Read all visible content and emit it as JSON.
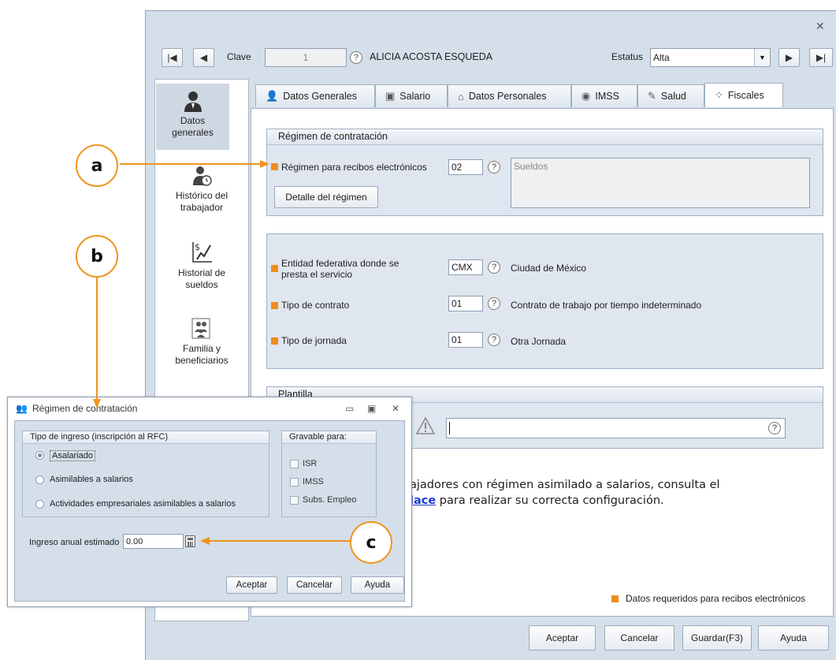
{
  "main_window": {
    "header": {
      "clave_label": "Clave",
      "clave_value": "1",
      "employee_name": "ALICIA ACOSTA ESQUEDA",
      "estatus_label": "Estatus",
      "estatus_value": "Alta"
    },
    "sidebar": {
      "items": [
        {
          "label_line1": "Datos",
          "label_line2": "generales",
          "icon": "person-icon"
        },
        {
          "label_line1": "Histórico del",
          "label_line2": "trabajador",
          "icon": "person-clock-icon"
        },
        {
          "label_line1": "Historial de",
          "label_line2": "sueldos",
          "icon": "salary-chart-icon"
        },
        {
          "label_line1": "Familia y",
          "label_line2": "beneficiarios",
          "icon": "family-icon"
        }
      ]
    },
    "tabs": [
      {
        "label": "Datos Generales",
        "icon": "person-icon"
      },
      {
        "label": "Salario",
        "icon": "money-icon"
      },
      {
        "label": "Datos Personales",
        "icon": "house-icon"
      },
      {
        "label": "IMSS",
        "icon": "imss-icon"
      },
      {
        "label": "Salud",
        "icon": "syringe-icon"
      },
      {
        "label": "Fiscales",
        "icon": "grid-icon"
      }
    ],
    "regimen_group": {
      "title": "Régimen de contratación",
      "regimen_label": "Régimen para recibos electrónicos",
      "regimen_code": "02",
      "regimen_desc": "Sueldos",
      "detalle_button": "Detalle del régimen"
    },
    "entidad_group": {
      "entidad_label_line1": "Entidad federativa donde se",
      "entidad_label_line2": "presta el servicio",
      "entidad_code": "CMX",
      "entidad_desc": "Ciudad de México",
      "contrato_label": "Tipo de contrato",
      "contrato_code": "01",
      "contrato_desc": "Contrato de trabajo por tiempo indeterminado",
      "jornada_label": "Tipo de jornada",
      "jornada_code": "01",
      "jornada_desc": "Otra Jornada"
    },
    "plantilla_group": {
      "title_partial": "Plantilla"
    },
    "info_text": {
      "line1": "ajadores con régimen asimilado a salarios, consulta el",
      "link": "lace",
      "line2_rest": " para realizar su correcta configuración."
    },
    "legend": "Datos requeridos para recibos electrónicos",
    "footer_buttons": {
      "aceptar": "Aceptar",
      "cancelar": "Cancelar",
      "guardar": "Guardar(F3)",
      "ayuda": "Ayuda"
    }
  },
  "dialog": {
    "title": "Régimen de contratación",
    "tipo_group": {
      "title": "Tipo de ingreso (inscripción al RFC)",
      "options": [
        "Asalariado",
        "Asimilables a salarios",
        "Actividades empresariales asimilables a salarios"
      ],
      "selected": "Asalariado"
    },
    "gravable_group": {
      "title": "Gravable para:",
      "options": [
        "ISR",
        "IMSS",
        "Subs. Empleo"
      ]
    },
    "ingreso_label": "Ingreso anual estimado",
    "ingreso_value": "0.00",
    "buttons": {
      "aceptar": "Aceptar",
      "cancelar": "Cancelar",
      "ayuda": "Ayuda"
    }
  },
  "callouts": {
    "a": "a",
    "b": "b",
    "c": "c"
  },
  "colors": {
    "accent_orange": "#f0941e",
    "required_marker": "#f08c1e",
    "link": "#1a3fd0"
  }
}
